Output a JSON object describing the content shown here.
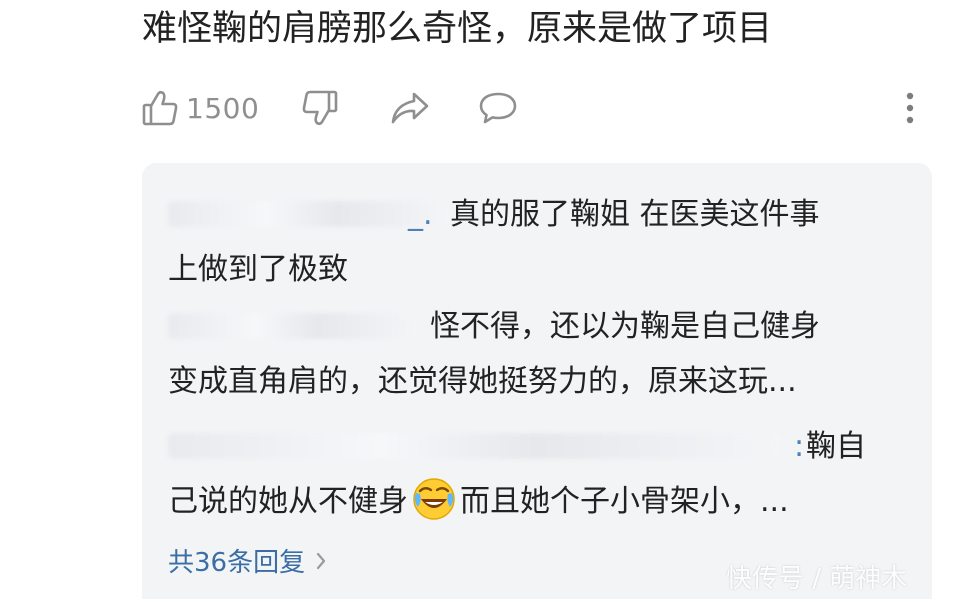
{
  "comment": {
    "text": "难怪鞠的肩膀那么奇怪，原来是做了项目",
    "like_count": "1500"
  },
  "replies": [
    {
      "name_tail": "_.",
      "line1": "真的服了鞠姐 在医美这件事",
      "line2": "上做到了极致"
    },
    {
      "line1": "怪不得，还以为鞠是自己健身",
      "line2": "变成直角肩的，还觉得她挺努力的，原来这玩..."
    },
    {
      "name_tail": ":",
      "line1": "鞠自",
      "line2_before_emoji": "己说的她从不健身",
      "emoji": "laughing-crying-emoji",
      "line2_after_emoji": "而且她个子小骨架小，..."
    }
  ],
  "view_replies_label": "共36条回复",
  "watermark": "快传号 / 萌神木",
  "colors": {
    "link": "#3a6ea5",
    "icon": "#8f8f8f",
    "reply_bg": "#f3f4f6"
  },
  "icons": [
    "thumbs-up-icon",
    "thumbs-down-icon",
    "share-icon",
    "comment-icon",
    "more-vertical-icon",
    "chevron-right-icon"
  ]
}
